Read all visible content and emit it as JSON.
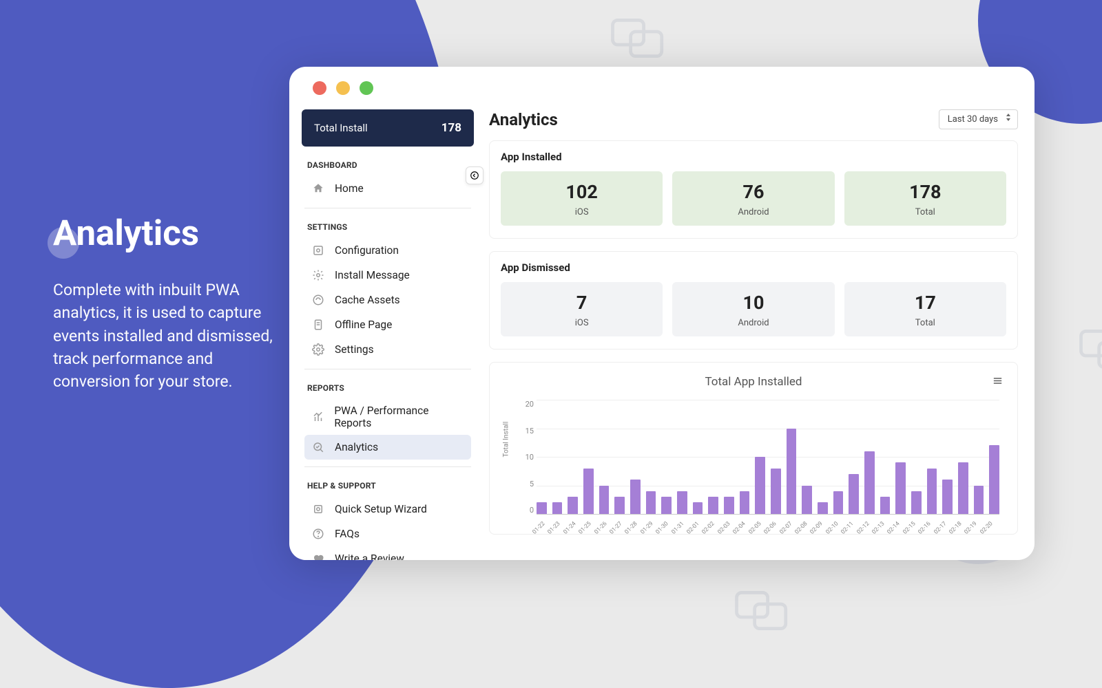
{
  "hero": {
    "title": "Analytics",
    "subtitle": "Complete with inbuilt PWA analytics, it is used to capture events installed and dismissed, track performance and conversion for your store."
  },
  "sidebar": {
    "total_label": "Total Install",
    "total_value": "178",
    "sections": {
      "dashboard": {
        "label": "DASHBOARD",
        "items": [
          {
            "label": "Home"
          }
        ]
      },
      "settings": {
        "label": "SETTINGS",
        "items": [
          {
            "label": "Configuration"
          },
          {
            "label": "Install Message"
          },
          {
            "label": "Cache Assets"
          },
          {
            "label": "Offline Page"
          },
          {
            "label": "Settings"
          }
        ]
      },
      "reports": {
        "label": "REPORTS",
        "items": [
          {
            "label": "PWA / Performance Reports"
          },
          {
            "label": "Analytics"
          }
        ]
      },
      "help": {
        "label": "HELP & SUPPORT",
        "items": [
          {
            "label": "Quick Setup Wizard"
          },
          {
            "label": "FAQs"
          },
          {
            "label": "Write a Review"
          }
        ]
      }
    }
  },
  "main": {
    "title": "Analytics",
    "period": "Last 30 days",
    "installed": {
      "title": "App Installed",
      "ios": "102",
      "android": "76",
      "total": "178",
      "ios_l": "iOS",
      "android_l": "Android",
      "total_l": "Total"
    },
    "dismissed": {
      "title": "App Dismissed",
      "ios": "7",
      "android": "10",
      "total": "17",
      "ios_l": "iOS",
      "android_l": "Android",
      "total_l": "Total"
    }
  },
  "chart_data": {
    "type": "bar",
    "title": "Total App Installed",
    "ylabel": "Total Install",
    "ylim": [
      0,
      20
    ],
    "yticks": [
      "20",
      "15",
      "10",
      "5",
      "0"
    ],
    "categories": [
      "01-22",
      "01-23",
      "01-24",
      "01-25",
      "01-26",
      "01-27",
      "01-28",
      "01-29",
      "01-30",
      "01-31",
      "02-01",
      "02-02",
      "02-03",
      "02-04",
      "02-05",
      "02-06",
      "02-07",
      "02-08",
      "02-09",
      "02-10",
      "02-11",
      "02-12",
      "02-13",
      "02-14",
      "02-15",
      "02-16",
      "02-17",
      "02-18",
      "02-19",
      "02-20"
    ],
    "values": [
      2,
      2,
      3,
      8,
      5,
      3,
      6,
      4,
      3,
      4,
      2,
      3,
      3,
      4,
      10,
      8,
      15,
      5,
      2,
      4,
      7,
      11,
      3,
      9,
      4,
      8,
      6,
      9,
      5,
      12
    ]
  }
}
